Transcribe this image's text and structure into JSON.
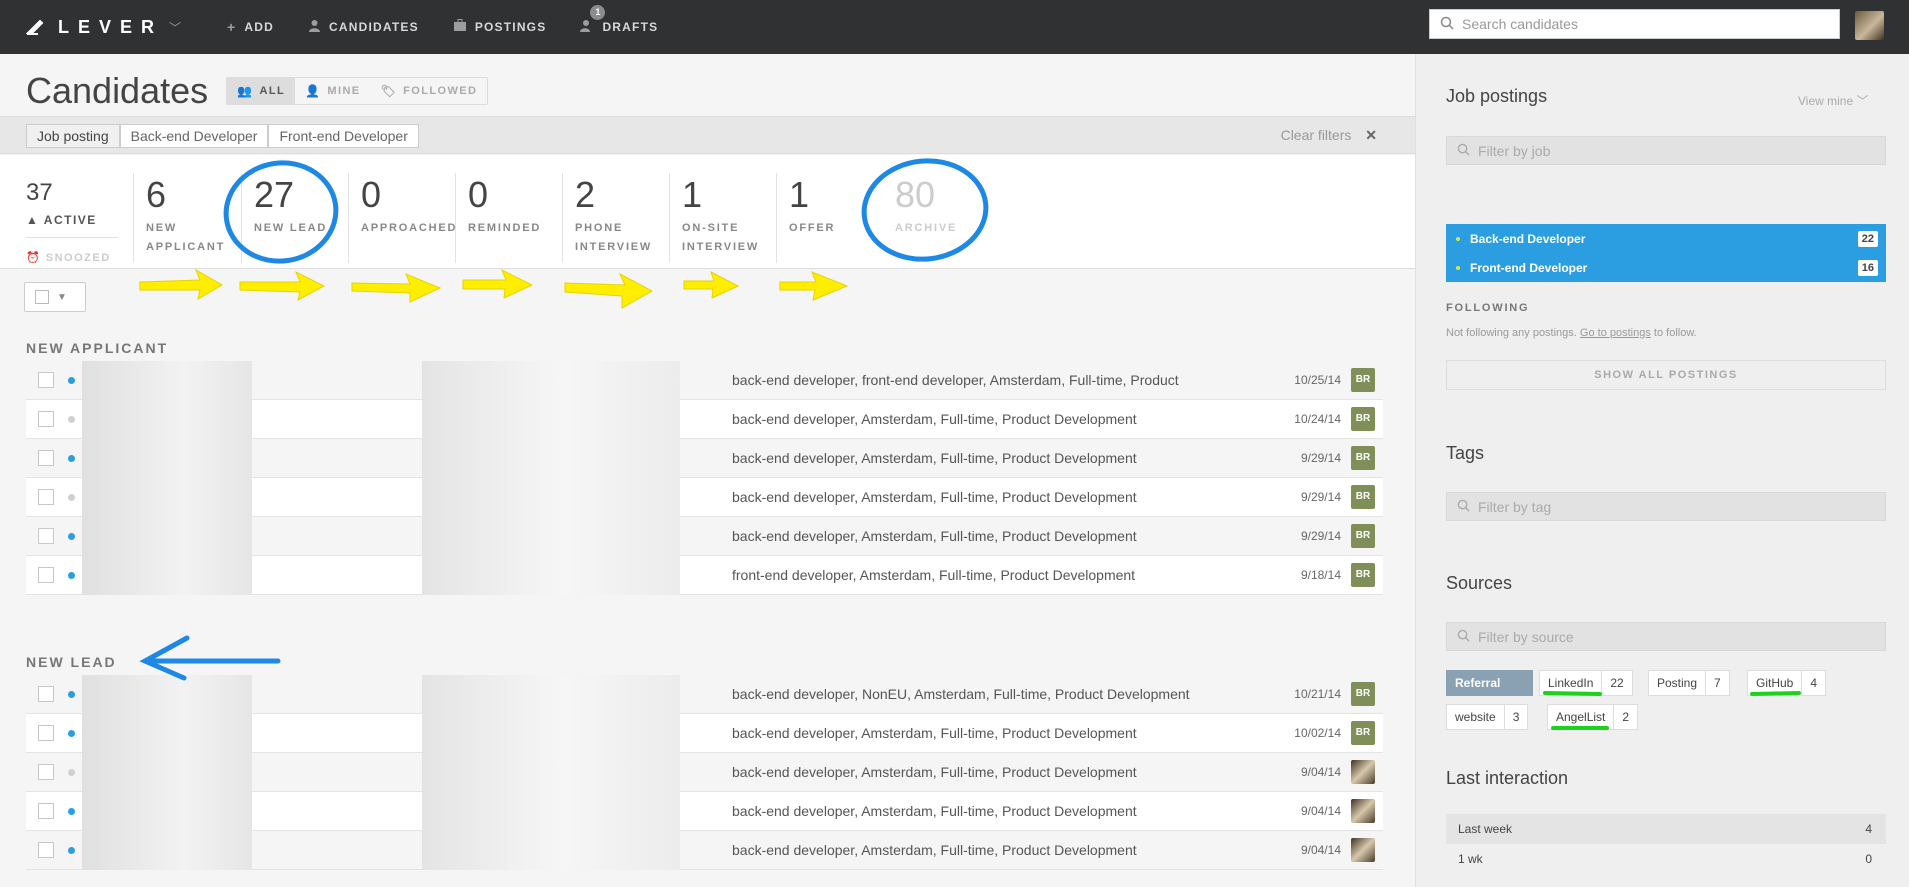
{
  "topbar": {
    "brand": "LEVER",
    "nav": [
      {
        "label": "ADD",
        "icon": "plus-icon",
        "glyph": "+"
      },
      {
        "label": "CANDIDATES",
        "icon": "person-icon",
        "glyph": "👤"
      },
      {
        "label": "POSTINGS",
        "icon": "briefcase-icon",
        "glyph": "▣"
      },
      {
        "label": "DRAFTS",
        "icon": "drafts-icon",
        "glyph": "✎",
        "badge": "1"
      }
    ],
    "search_placeholder": "Search candidates"
  },
  "page": {
    "title": "Candidates",
    "views": [
      {
        "label": "ALL",
        "glyph": "👥"
      },
      {
        "label": "MINE",
        "glyph": "👤"
      },
      {
        "label": "FOLLOWED",
        "glyph": "🏷"
      }
    ]
  },
  "filters": {
    "chips": [
      "Job posting",
      "Back-end Developer",
      "Front-end Developer"
    ],
    "clear_label": "Clear filters",
    "clear_glyph": "✕"
  },
  "summary": {
    "active_count": "37",
    "active_label": "ACTIVE",
    "snoozed_label": "SNOOZED"
  },
  "stages": [
    {
      "count": "6",
      "label1": "NEW",
      "label2": "APPLICANT"
    },
    {
      "count": "27",
      "label1": "NEW LEAD",
      "label2": ""
    },
    {
      "count": "0",
      "label1": "APPROACHED",
      "label2": ""
    },
    {
      "count": "0",
      "label1": "REMINDED",
      "label2": ""
    },
    {
      "count": "2",
      "label1": "PHONE",
      "label2": "INTERVIEW"
    },
    {
      "count": "1",
      "label1": "ON-SITE",
      "label2": "INTERVIEW"
    },
    {
      "count": "1",
      "label1": "OFFER",
      "label2": ""
    },
    {
      "count": "80",
      "label1": "ARCHIVE",
      "label2": ""
    }
  ],
  "sections": [
    {
      "title": "NEW APPLICANT",
      "rows": [
        {
          "tags": "back-end developer, front-end developer, Amsterdam, Full-time, Product",
          "date": "10/25/14",
          "owner": "BR",
          "unread": true
        },
        {
          "tags": "back-end developer, Amsterdam, Full-time, Product Development",
          "date": "10/24/14",
          "owner": "BR",
          "unread": false
        },
        {
          "tags": "back-end developer, Amsterdam, Full-time, Product Development",
          "date": "9/29/14",
          "owner": "BR",
          "unread": true
        },
        {
          "tags": "back-end developer, Amsterdam, Full-time, Product Development",
          "date": "9/29/14",
          "owner": "BR",
          "unread": false
        },
        {
          "tags": "back-end developer, Amsterdam, Full-time, Product Development",
          "date": "9/29/14",
          "owner": "BR",
          "unread": true
        },
        {
          "tags": "front-end developer, Amsterdam, Full-time, Product Development",
          "date": "9/18/14",
          "owner": "BR",
          "unread": true
        }
      ]
    },
    {
      "title": "NEW LEAD",
      "rows": [
        {
          "tags": "back-end developer, NonEU, Amsterdam, Full-time, Product Development",
          "date": "10/21/14",
          "owner": "BR",
          "unread": true
        },
        {
          "tags": "back-end developer, Amsterdam, Full-time, Product Development",
          "date": "10/02/14",
          "owner": "BR",
          "unread": true
        },
        {
          "tags": "back-end developer, Amsterdam, Full-time, Product Development",
          "date": "9/04/14",
          "owner": "",
          "unread": false
        },
        {
          "tags": "back-end developer, Amsterdam, Full-time, Product Development",
          "date": "9/04/14",
          "owner": "",
          "unread": true
        },
        {
          "tags": "back-end developer, Amsterdam, Full-time, Product Development",
          "date": "9/04/14",
          "owner": "",
          "unread": true
        }
      ]
    }
  ],
  "sidebar": {
    "job_postings_title": "Job postings",
    "view_mine": "View mine",
    "job_filter_placeholder": "Filter by job",
    "jobs": [
      {
        "name": "Back-end Developer",
        "count": "22"
      },
      {
        "name": "Front-end Developer",
        "count": "16"
      }
    ],
    "following_title": "FOLLOWING",
    "following_text": "Not following any postings.",
    "following_link": "Go to postings",
    "following_suffix": "to follow.",
    "show_all": "SHOW ALL POSTINGS",
    "tags_title": "Tags",
    "tag_filter_placeholder": "Filter by tag",
    "sources_title": "Sources",
    "source_filter_placeholder": "Filter by source",
    "sources": [
      {
        "name": "Referral",
        "count": ""
      },
      {
        "name": "LinkedIn",
        "count": "22"
      },
      {
        "name": "Posting",
        "count": "7"
      },
      {
        "name": "GitHub",
        "count": "4"
      },
      {
        "name": "website",
        "count": "3"
      },
      {
        "name": "AngelList",
        "count": "2"
      }
    ],
    "last_interaction_title": "Last interaction",
    "last_interaction": [
      {
        "label": "Last week",
        "count": "4"
      },
      {
        "label": "1 wk",
        "count": "0"
      }
    ]
  },
  "colors": {
    "accent": "#2a9ee0",
    "topbar": "#2f3133",
    "annotation_blue": "#1e88e5",
    "annotation_yellow": "#ffee00",
    "annotation_green": "#1fd11f"
  }
}
